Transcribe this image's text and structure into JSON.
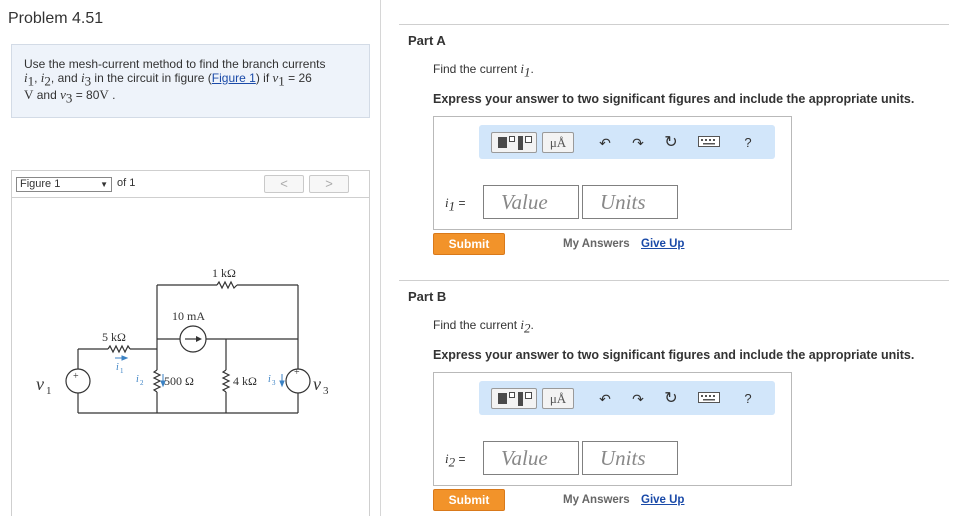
{
  "problem": {
    "title": "Problem 4.51",
    "text_1": "Use the mesh-current method to find the branch currents",
    "var_i1": "i",
    "sub_1": "1",
    "comma": ", ",
    "var_i2": "i",
    "sub_2": "2",
    "and": ", and ",
    "var_i3": "i",
    "sub_3": "3",
    "text_2": " in the circuit in figure (",
    "figure_link": "Figure 1",
    "text_3": ") if ",
    "var_v1": "v",
    "v1_eq": " = 26",
    "unit_v": "V",
    "text_and": " and ",
    "var_v3": "v",
    "v3_eq": " = 80",
    "unit_v2": "V",
    "period": " ."
  },
  "figure": {
    "select_value": "Figure 1",
    "of_label": "of 1",
    "prev": "<",
    "next": ">",
    "labels": {
      "r_top": "1 kΩ",
      "cs": "10 mA",
      "r_left": "5 kΩ",
      "r_mid": "500 Ω",
      "r_right": "4 kΩ",
      "v1": "v",
      "v1_sub": "1",
      "v3": "v",
      "v3_sub": "3",
      "i1": "i",
      "i1_sub": "1",
      "i2": "i",
      "i2_sub": "2",
      "i3": "i",
      "i3_sub": "3",
      "plus": "+"
    }
  },
  "parts": [
    {
      "title": "Part A",
      "question_prefix": "Find the current ",
      "var": "i",
      "sub": "1",
      "question_suffix": ".",
      "instruction": "Express your answer to two significant figures and include the appropriate units.",
      "label_var": "i",
      "label_sub": "1",
      "label_eq": " =",
      "value_placeholder": "Value",
      "units_placeholder": "Units",
      "submit": "Submit",
      "my_answers": "My Answers",
      "give_up": "Give Up"
    },
    {
      "title": "Part B",
      "question_prefix": "Find the current ",
      "var": "i",
      "sub": "2",
      "question_suffix": ".",
      "instruction": "Express your answer to two significant figures and include the appropriate units.",
      "label_var": "i",
      "label_sub": "2",
      "label_eq": " =",
      "value_placeholder": "Value",
      "units_placeholder": "Units",
      "submit": "Submit",
      "my_answers": "My Answers",
      "give_up": "Give Up"
    }
  ],
  "toolbar": {
    "units_label": "μÅ",
    "undo": "↶",
    "redo": "↷",
    "reset": "↻",
    "help": "?",
    "icons": [
      "fraction-template-icon",
      "units-icon",
      "undo-icon",
      "redo-icon",
      "reset-icon",
      "keyboard-icon",
      "help-icon"
    ]
  },
  "colors": {
    "submit": "#f2932a",
    "link": "#1a4aa8",
    "toolbar_bg": "#d2e6fa",
    "problem_bg": "#eef3fa"
  }
}
